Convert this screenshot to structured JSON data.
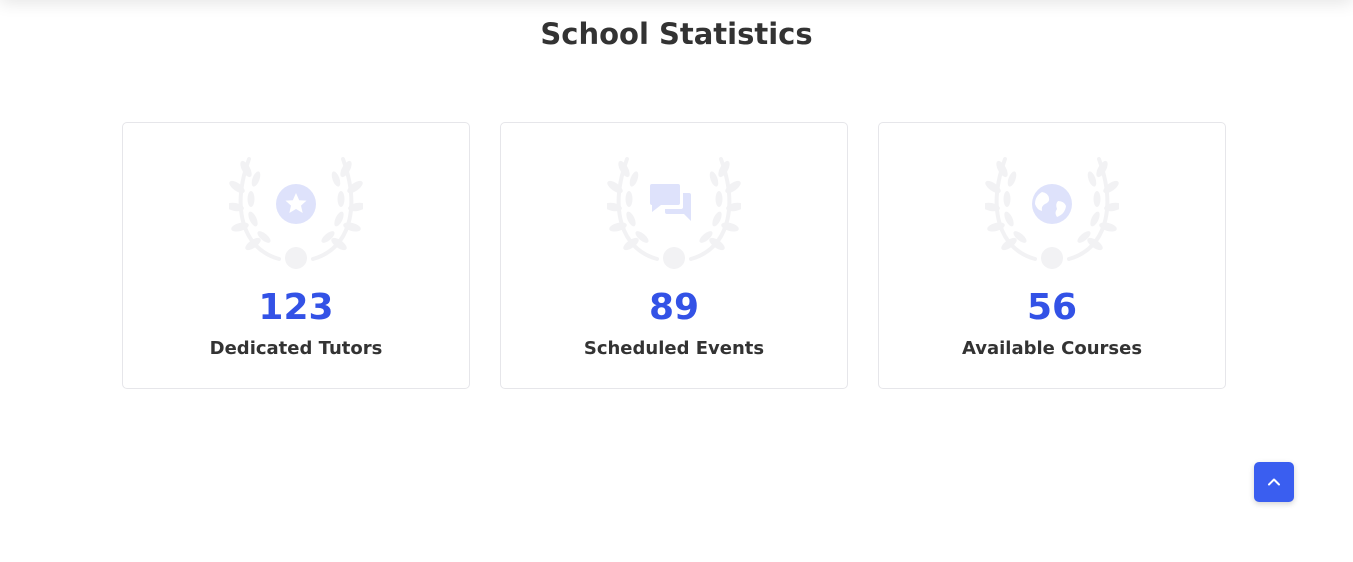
{
  "section": {
    "title": "School Statistics"
  },
  "stats": [
    {
      "value": "123",
      "label": "Dedicated Tutors",
      "icon": "star-icon"
    },
    {
      "value": "89",
      "label": "Scheduled Events",
      "icon": "chat-icon"
    },
    {
      "value": "56",
      "label": "Available Courses",
      "icon": "globe-icon"
    }
  ],
  "back_to_top": {
    "icon": "chevron-up-icon"
  },
  "colors": {
    "accent": "#3352e6",
    "button": "#3a5ef0",
    "emblem_icon": "#dee2fb",
    "laurel": "#f2f2f4",
    "text": "#333333"
  }
}
